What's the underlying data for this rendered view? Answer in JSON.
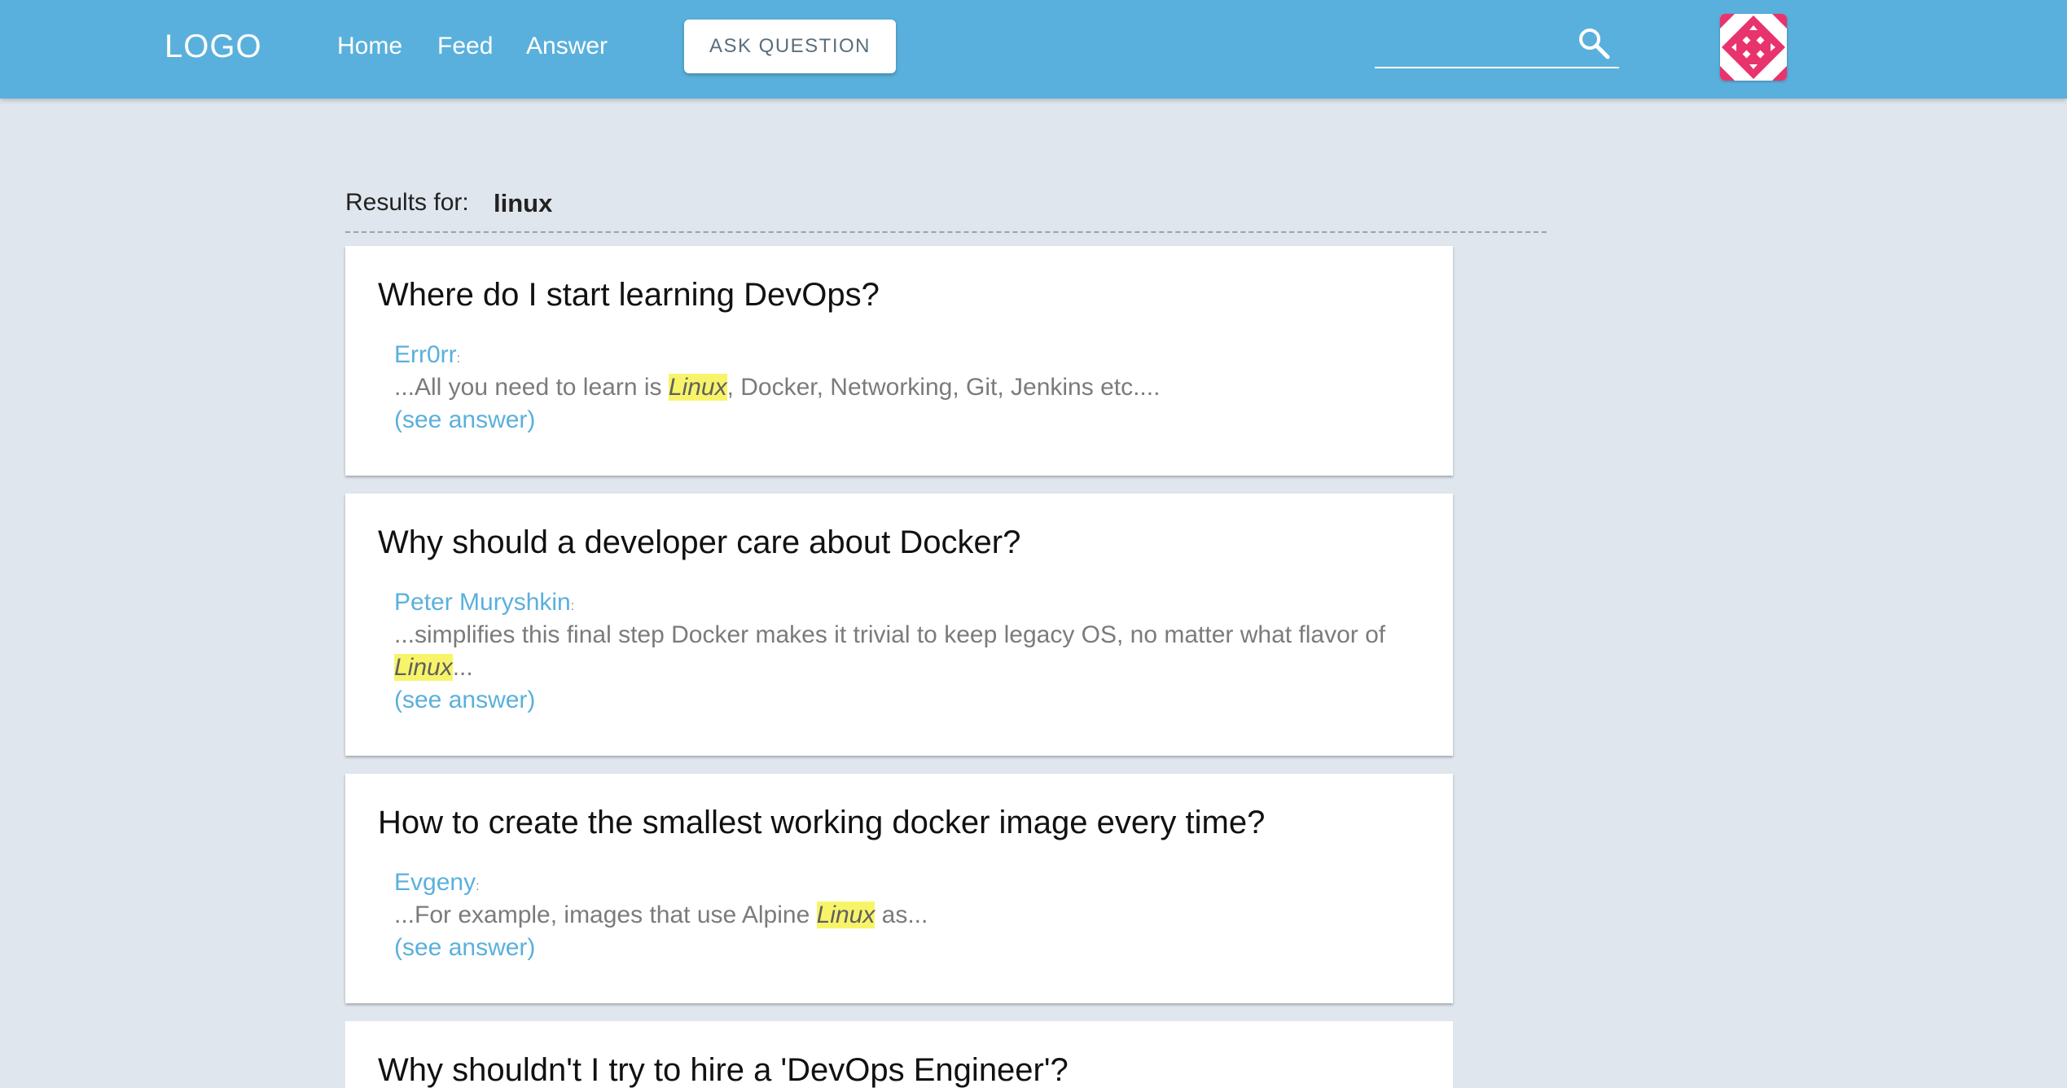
{
  "header": {
    "logo": "LOGO",
    "nav": [
      "Home",
      "Feed",
      "Answer"
    ],
    "ask_button": "ASK QUESTION",
    "search_value": "",
    "colors": {
      "bar": "#5ab0dc",
      "avatar_accent": "#e8336d"
    }
  },
  "results": {
    "label": "Results for:",
    "query": "linux",
    "items": [
      {
        "title": "Where do I start learning DevOps?",
        "author": "Err0rr",
        "before": "...All you need to learn is ",
        "highlight": "Linux",
        "after": ", Docker, Networking, Git, Jenkins etc....",
        "link": "(see answer)"
      },
      {
        "title": "Why should a developer care about Docker?",
        "author": "Peter Muryshkin",
        "before": "...simplifies this final step Docker makes it trivial to keep legacy OS, no matter what flavor of ",
        "highlight": "Linux",
        "after": "...",
        "link": "(see answer)"
      },
      {
        "title": "How to create the smallest working docker image every time?",
        "author": "Evgeny",
        "before": "...For example, images that use Alpine ",
        "highlight": "Linux",
        "after": " as...",
        "link": "(see answer)"
      },
      {
        "title": "Why shouldn't I try to hire a 'DevOps Engineer'?",
        "author": "",
        "before": "",
        "highlight": "",
        "after": "",
        "link": ""
      }
    ]
  }
}
